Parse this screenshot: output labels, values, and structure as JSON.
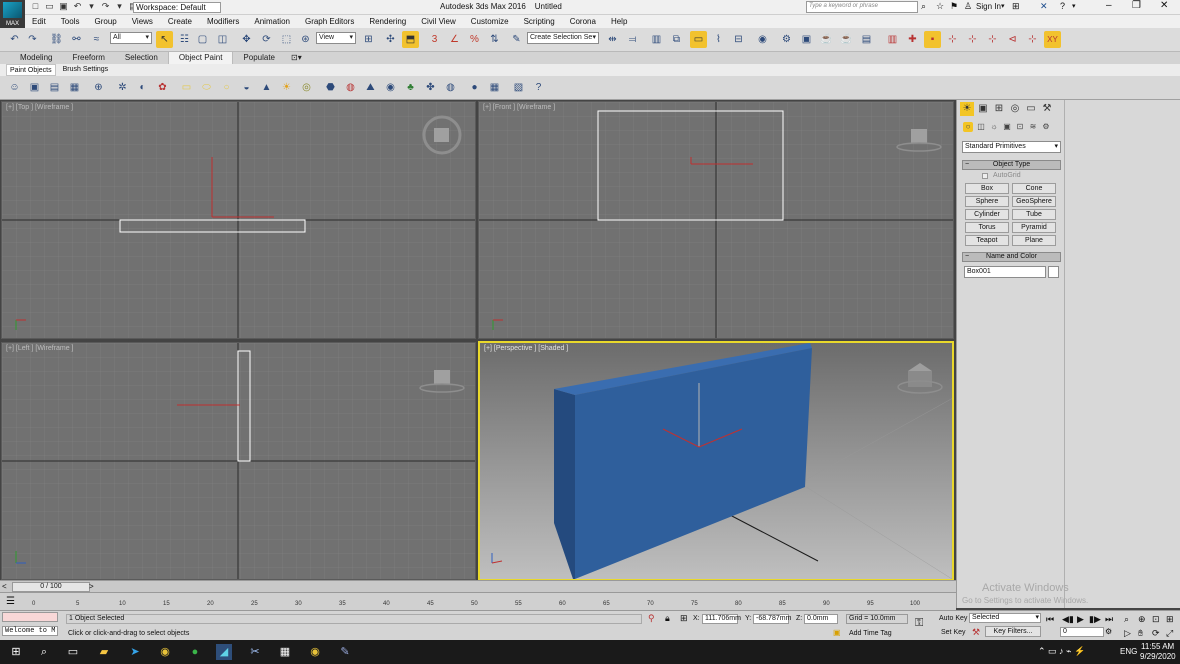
{
  "window": {
    "app_title": "Autodesk 3ds Max 2016",
    "doc_title": "Untitled",
    "workspace": "Workspace: Default",
    "search_placeholder": "Type a keyword or phrase",
    "sign_in": "Sign In",
    "logo_caption": "MAX"
  },
  "menu": [
    "Edit",
    "Tools",
    "Group",
    "Views",
    "Create",
    "Modifiers",
    "Animation",
    "Graph Editors",
    "Rendering",
    "Civil View",
    "Customize",
    "Scripting",
    "Corona",
    "Help"
  ],
  "toolbar": {
    "filter": "All",
    "ref_coord": "View",
    "named_selection": "Create Selection Se"
  },
  "ribbon": {
    "tabs": [
      "Modeling",
      "Freeform",
      "Selection",
      "Object Paint",
      "Populate"
    ],
    "active": "Object Paint",
    "subtabs": [
      "Paint Objects",
      "Brush Settings"
    ]
  },
  "viewports": {
    "top": "[+] [Top ] [Wireframe ]",
    "front": "[+] [Front ] [Wireframe ]",
    "left": "[+] [Left ] [Wireframe ]",
    "persp": "[+] [Perspective ] [Shaded ]"
  },
  "command_panel": {
    "category": "Standard Primitives",
    "object_type_header": "Object Type",
    "autogrid": "AutoGrid",
    "buttons": [
      "Box",
      "Cone",
      "Sphere",
      "GeoSphere",
      "Cylinder",
      "Tube",
      "Torus",
      "Pyramid",
      "Teapot",
      "Plane"
    ],
    "name_color_header": "Name and Color",
    "object_name": "Box001"
  },
  "timeline": {
    "frame": "0 / 100",
    "ticks": [
      "0",
      "5",
      "10",
      "15",
      "20",
      "25",
      "30",
      "35",
      "40",
      "45",
      "50",
      "55",
      "60",
      "65",
      "70",
      "75",
      "80",
      "85",
      "90",
      "95",
      "100"
    ]
  },
  "status": {
    "maxscript": "Welcome to M",
    "selection": "1 Object Selected",
    "prompt": "Click or click-and-drag to select objects",
    "x_label": "X:",
    "x": "111.706mm",
    "y_label": "Y:",
    "y": "-68.787mm",
    "z_label": "Z:",
    "z": "0.0mm",
    "grid": "Grid = 10.0mm",
    "add_time_tag": "Add Time Tag",
    "auto_key": "Auto Key",
    "set_key": "Set Key",
    "key_mode": "Selected",
    "key_filters": "Key Filters...",
    "frame_field": "0"
  },
  "watermark": {
    "line1": "Activate Windows",
    "line2": "Go to Settings to activate Windows."
  },
  "taskbar": {
    "lang": "ENG",
    "time": "11:55 AM",
    "date": "9/29/2020"
  },
  "colors": {
    "box": "#2f5f9c",
    "active_border": "#e9d82b",
    "selection_highlight": "#f2c22e"
  }
}
